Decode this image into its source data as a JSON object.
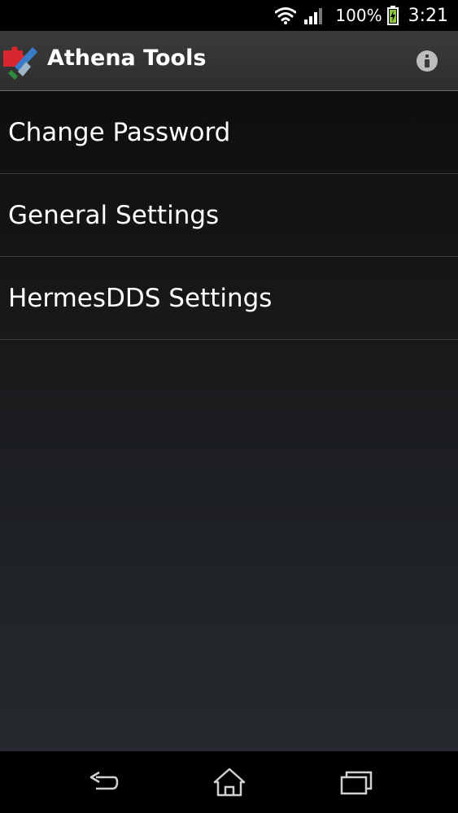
{
  "status_bar": {
    "battery_percent": "100%",
    "time": "3:21",
    "icons": [
      "wifi-icon",
      "signal-icon",
      "battery-charging-icon"
    ]
  },
  "action_bar": {
    "app_icon": "tools-puzzle-icon",
    "title": "Athena Tools",
    "info_icon": "info-icon"
  },
  "menu": {
    "items": [
      {
        "label": "Change Password"
      },
      {
        "label": "General Settings"
      },
      {
        "label": "HermesDDS Settings"
      }
    ]
  },
  "nav_bar": {
    "icons": [
      "back-icon",
      "home-icon",
      "recent-apps-icon"
    ]
  },
  "colors": {
    "background_top": "#0e0e0e",
    "background_bottom": "#262a2f",
    "action_bar": "#333333",
    "divider": "#3b3b3b"
  }
}
